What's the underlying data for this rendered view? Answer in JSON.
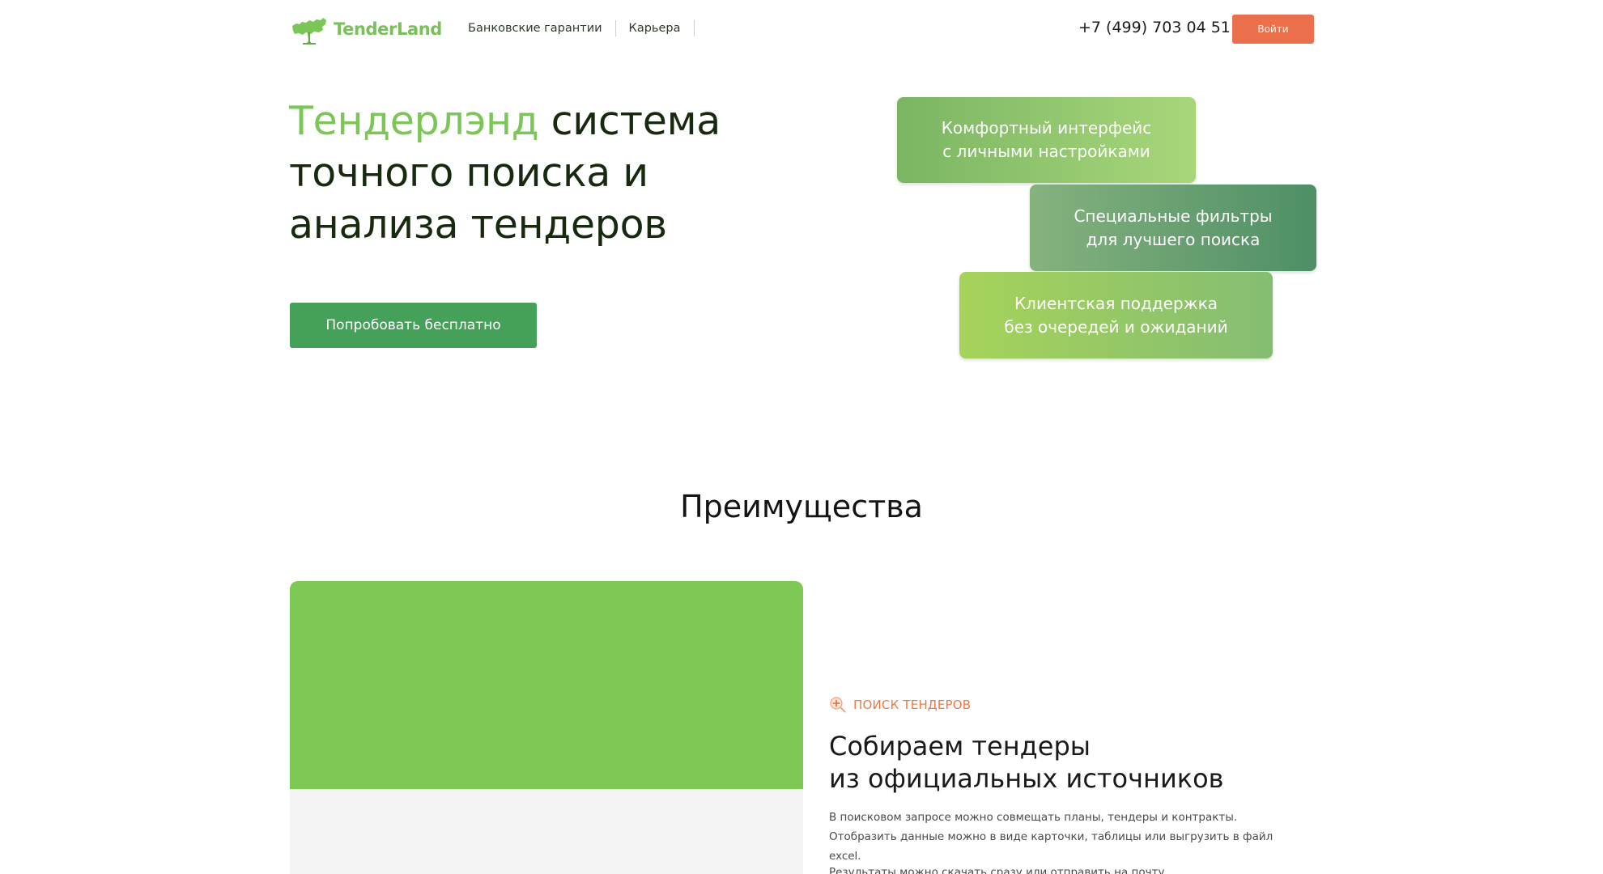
{
  "brand": {
    "name": "TenderLand",
    "logo_icon": "tree-map-logo-icon",
    "accent_color": "#7cc657"
  },
  "nav": {
    "items": [
      {
        "label": "Банковские гарантии"
      },
      {
        "label": "Карьера"
      }
    ]
  },
  "header": {
    "phone": "+7 (499) 703 04 51",
    "login_label": "Войти",
    "login_color": "#ec6f4b"
  },
  "hero": {
    "title_accent": "Тендерлэнд",
    "title_rest": " система точного поиска и анализа тендеров",
    "cta_label": "Попробовать бесплатно",
    "cta_color": "#45a159",
    "cards": [
      {
        "line1": "Комфортный интерфейс",
        "line2": "с личными настройками"
      },
      {
        "line1": "Специальные фильтры",
        "line2": "для лучшего поиска"
      },
      {
        "line1": "Клиентская поддержка",
        "line2": "без очередей и ожиданий"
      }
    ]
  },
  "advantages": {
    "title": "Преимущества",
    "tag_icon": "search-plus-icon",
    "tag_label": "ПОИСК ТЕНДЕРОВ",
    "item_title_line1": "Собираем тендеры",
    "item_title_line2": "из официальных источников",
    "text_1": "В поисковом запросе можно совмещать планы, тендеры и контракты. Отобразить данные можно в виде карточки, таблицы или выгрузить в файл excel.",
    "text_2": "Результаты можно скачать сразу или отправить на почту"
  }
}
